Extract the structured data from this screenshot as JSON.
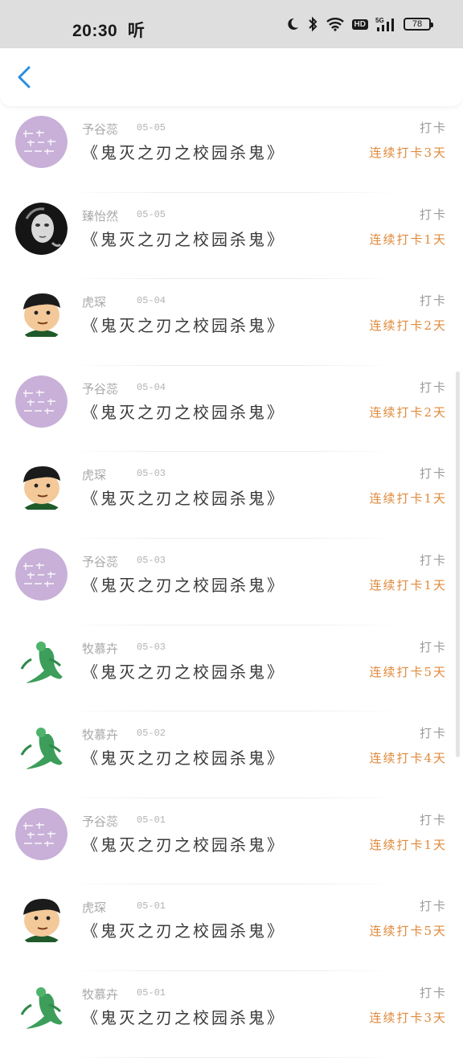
{
  "status_bar": {
    "time": "20:30",
    "extra": "听",
    "network": "5G",
    "hd": "HD",
    "battery": "78"
  },
  "colors": {
    "accent_back": "#2a8de0",
    "streak": "#e08a3c"
  },
  "items": [
    {
      "avatar": "purple-text-avatar",
      "username": "予谷蕊",
      "date": "05-05",
      "title": "《鬼灭之刃之校园杀鬼》",
      "action": "打卡",
      "streak": "连续打卡3天"
    },
    {
      "avatar": "bw-photo-avatar",
      "username": "臻怡然",
      "date": "05-05",
      "title": "《鬼灭之刃之校园杀鬼》",
      "action": "打卡",
      "streak": "连续打卡1天"
    },
    {
      "avatar": "cartoon-boy-avatar",
      "username": "虎琛",
      "date": "05-04",
      "title": "《鬼灭之刃之校园杀鬼》",
      "action": "打卡",
      "streak": "连续打卡2天"
    },
    {
      "avatar": "purple-text-avatar",
      "username": "予谷蕊",
      "date": "05-04",
      "title": "《鬼灭之刃之校园杀鬼》",
      "action": "打卡",
      "streak": "连续打卡2天"
    },
    {
      "avatar": "cartoon-boy-avatar",
      "username": "虎琛",
      "date": "05-03",
      "title": "《鬼灭之刃之校园杀鬼》",
      "action": "打卡",
      "streak": "连续打卡1天"
    },
    {
      "avatar": "purple-text-avatar",
      "username": "予谷蕊",
      "date": "05-03",
      "title": "《鬼灭之刃之校园杀鬼》",
      "action": "打卡",
      "streak": "连续打卡1天"
    },
    {
      "avatar": "green-figure-avatar",
      "username": "牧慕卉",
      "date": "05-03",
      "title": "《鬼灭之刃之校园杀鬼》",
      "action": "打卡",
      "streak": "连续打卡5天"
    },
    {
      "avatar": "green-figure-avatar",
      "username": "牧慕卉",
      "date": "05-02",
      "title": "《鬼灭之刃之校园杀鬼》",
      "action": "打卡",
      "streak": "连续打卡4天"
    },
    {
      "avatar": "purple-text-avatar",
      "username": "予谷蕊",
      "date": "05-01",
      "title": "《鬼灭之刃之校园杀鬼》",
      "action": "打卡",
      "streak": "连续打卡1天"
    },
    {
      "avatar": "cartoon-boy-avatar",
      "username": "虎琛",
      "date": "05-01",
      "title": "《鬼灭之刃之校园杀鬼》",
      "action": "打卡",
      "streak": "连续打卡5天"
    },
    {
      "avatar": "green-figure-avatar",
      "username": "牧慕卉",
      "date": "05-01",
      "title": "《鬼灭之刃之校园杀鬼》",
      "action": "打卡",
      "streak": "连续打卡3天"
    }
  ]
}
